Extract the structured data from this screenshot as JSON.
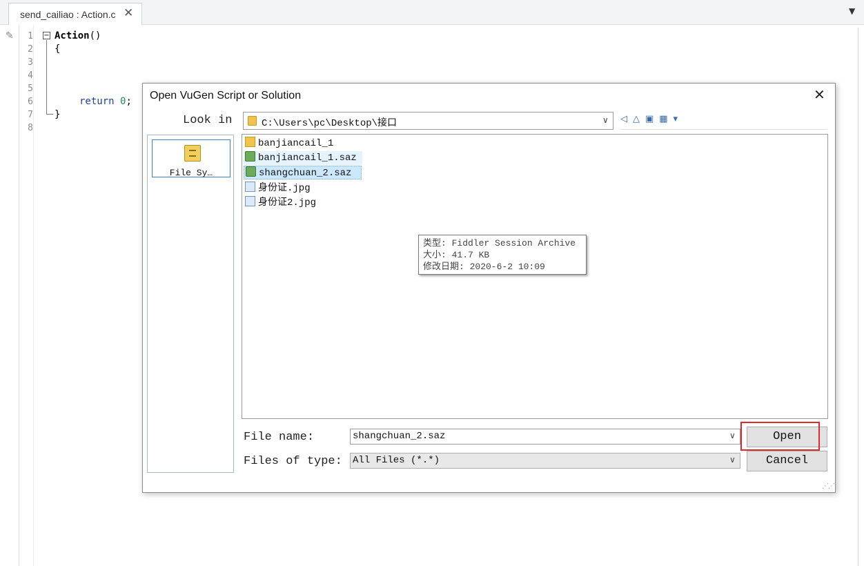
{
  "editor": {
    "tab_label": "send_cailiao : Action.c",
    "tab_close": "✕",
    "overflow_icon": "▼",
    "line_numbers": [
      "1",
      "2",
      "3",
      "4",
      "5",
      "6",
      "7",
      "8"
    ],
    "code": {
      "line1_keyword": "Action",
      "line1_rest": "()",
      "line2": "{",
      "line6_keyword": "return",
      "line6_value": "0",
      "line6_end": ";",
      "line7": "}"
    }
  },
  "dialog": {
    "title": "Open VuGen Script or Solution",
    "close": "✕",
    "look_in_label": "Look in",
    "look_in_path": "C:\\Users\\pc\\Desktop\\接口",
    "dropdown_arrow": "∨",
    "nav_icons": "◁△▣▦▾",
    "places": [
      {
        "label": "File Sy…",
        "icon": "file-cabinet-icon"
      }
    ],
    "files": [
      {
        "name": "banjiancail_1",
        "icon": "folder-icon",
        "state": "normal"
      },
      {
        "name": "banjiancail_1.saz",
        "icon": "saz-file-icon",
        "state": "hover"
      },
      {
        "name": "shangchuan_2.saz",
        "icon": "saz-file-icon",
        "state": "selected"
      },
      {
        "name": "身份证.jpg",
        "icon": "image-file-icon",
        "state": "normal"
      },
      {
        "name": "身份证2.jpg",
        "icon": "image-file-icon",
        "state": "normal"
      }
    ],
    "tooltip": {
      "type_line": "类型: Fiddler Session Archive",
      "size_line": "大小: 41.7 KB",
      "date_line": "修改日期: 2020-6-2 10:09"
    },
    "file_name_label": "File name:",
    "file_name_value": "shangchuan_2.saz",
    "files_of_type_label": "Files of type:",
    "files_of_type_value": "All Files (*.*)",
    "open_button": "Open",
    "cancel_button": "Cancel",
    "highlight_color": "#e02a2a"
  }
}
